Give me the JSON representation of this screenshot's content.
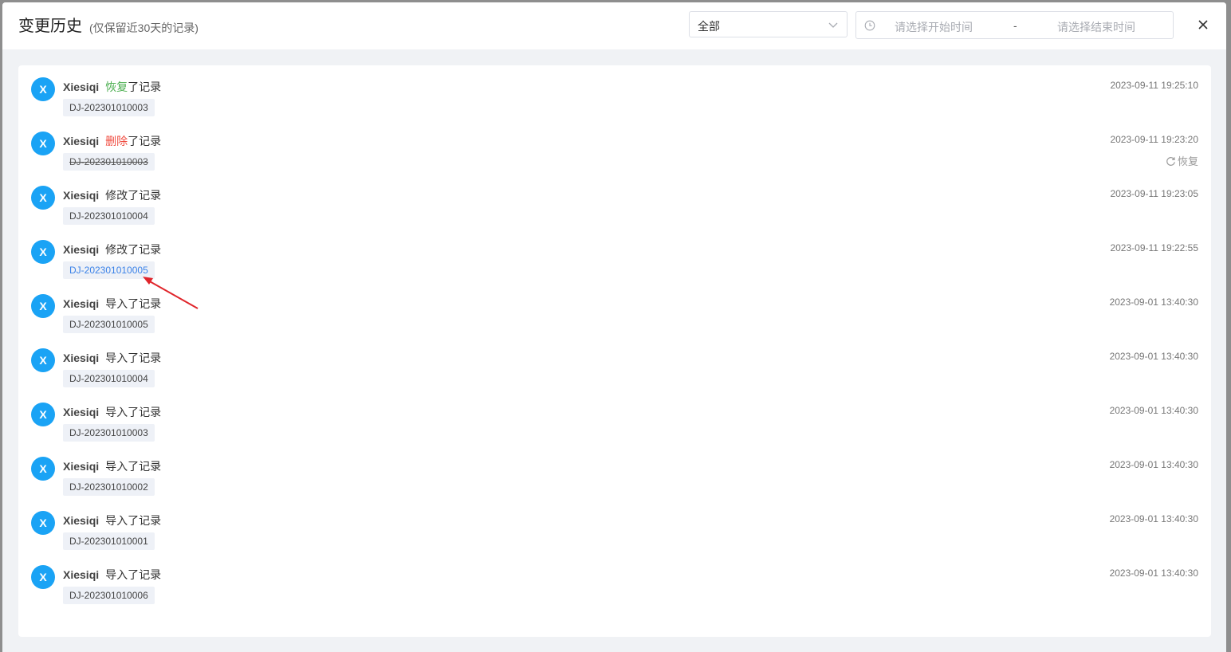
{
  "dialog": {
    "title": "变更历史",
    "subtitle": "(仅保留近30天的记录)"
  },
  "filter": {
    "type_selected": "全部",
    "start_placeholder": "请选择开始时间",
    "end_placeholder": "请选择结束时间",
    "range_separator": "-"
  },
  "icons": {
    "close": "close-icon",
    "clock": "clock-icon",
    "chevron": "chevron-down-icon",
    "refresh": "refresh-icon"
  },
  "colors": {
    "avatar": "#1aa3f5",
    "restore_action": "#4caf50",
    "delete_action": "#f04a3e",
    "link": "#3a82e8",
    "annotation_arrow": "#e0252b"
  },
  "records": [
    {
      "avatar": "X",
      "user": "Xiesiqi",
      "action": "恢复",
      "suffix": "了记录",
      "action_style": "restore",
      "code": "DJ-202301010003",
      "code_style": "normal",
      "time": "2023-09-11 19:25:10"
    },
    {
      "avatar": "X",
      "user": "Xiesiqi",
      "action": "删除",
      "suffix": "了记录",
      "action_style": "delete",
      "code": "DJ-202301010003",
      "code_style": "strike",
      "time": "2023-09-11 19:23:20",
      "restore_label": "恢复"
    },
    {
      "avatar": "X",
      "user": "Xiesiqi",
      "action": "修改",
      "suffix": "了记录",
      "action_style": "normal",
      "code": "DJ-202301010004",
      "code_style": "normal",
      "time": "2023-09-11 19:23:05"
    },
    {
      "avatar": "X",
      "user": "Xiesiqi",
      "action": "修改",
      "suffix": "了记录",
      "action_style": "normal",
      "code": "DJ-202301010005",
      "code_style": "link",
      "time": "2023-09-11 19:22:55"
    },
    {
      "avatar": "X",
      "user": "Xiesiqi",
      "action": "导入",
      "suffix": "了记录",
      "action_style": "normal",
      "code": "DJ-202301010005",
      "code_style": "normal",
      "time": "2023-09-01 13:40:30"
    },
    {
      "avatar": "X",
      "user": "Xiesiqi",
      "action": "导入",
      "suffix": "了记录",
      "action_style": "normal",
      "code": "DJ-202301010004",
      "code_style": "normal",
      "time": "2023-09-01 13:40:30"
    },
    {
      "avatar": "X",
      "user": "Xiesiqi",
      "action": "导入",
      "suffix": "了记录",
      "action_style": "normal",
      "code": "DJ-202301010003",
      "code_style": "normal",
      "time": "2023-09-01 13:40:30"
    },
    {
      "avatar": "X",
      "user": "Xiesiqi",
      "action": "导入",
      "suffix": "了记录",
      "action_style": "normal",
      "code": "DJ-202301010002",
      "code_style": "normal",
      "time": "2023-09-01 13:40:30"
    },
    {
      "avatar": "X",
      "user": "Xiesiqi",
      "action": "导入",
      "suffix": "了记录",
      "action_style": "normal",
      "code": "DJ-202301010001",
      "code_style": "normal",
      "time": "2023-09-01 13:40:30"
    },
    {
      "avatar": "X",
      "user": "Xiesiqi",
      "action": "导入",
      "suffix": "了记录",
      "action_style": "normal",
      "code": "DJ-202301010006",
      "code_style": "normal",
      "time": "2023-09-01 13:40:30"
    }
  ]
}
